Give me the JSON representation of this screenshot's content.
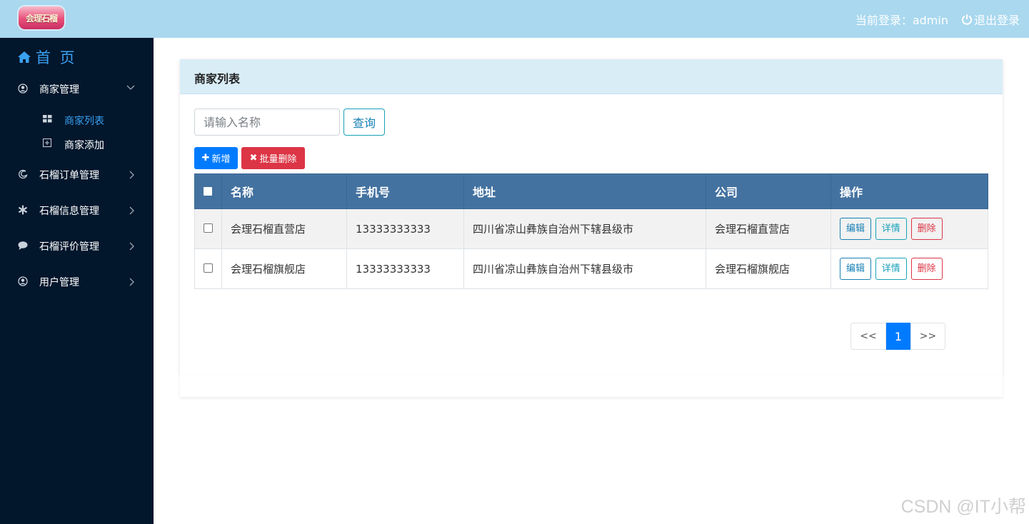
{
  "header": {
    "logo_text": "会理石榴",
    "current_user": "当前登录：admin",
    "logout_label": "退出登录"
  },
  "sidebar": {
    "home_label": "首 页",
    "items": [
      {
        "label": "商家管理",
        "icon": "user-circle-icon",
        "expanded": true
      },
      {
        "label": "石榴订单管理",
        "icon": "edge-icon"
      },
      {
        "label": "石榴信息管理",
        "icon": "asterisk-icon"
      },
      {
        "label": "石榴评价管理",
        "icon": "comment-icon"
      },
      {
        "label": "用户管理",
        "icon": "user-circle-icon"
      }
    ],
    "sub_items": [
      {
        "label": "商家列表",
        "icon": "grid-icon",
        "active": true
      },
      {
        "label": "商家添加",
        "icon": "plus-square-icon"
      }
    ]
  },
  "main": {
    "card_title": "商家列表",
    "search": {
      "placeholder": "请输入名称",
      "value": ""
    },
    "query_label": "查询",
    "add_label": "新增",
    "batch_delete_label": "批量删除",
    "table": {
      "columns": [
        "名称",
        "手机号",
        "地址",
        "公司",
        "操作"
      ],
      "rows": [
        {
          "name": "会理石榴直营店",
          "phone": "13333333333",
          "address": "四川省凉山彝族自治州下辖县级市",
          "company": "会理石榴直营店"
        },
        {
          "name": "会理石榴旗舰店",
          "phone": "13333333333",
          "address": "四川省凉山彝族自治州下辖县级市",
          "company": "会理石榴旗舰店"
        }
      ],
      "actions": {
        "edit": "编辑",
        "detail": "详情",
        "delete": "删除"
      }
    },
    "pagination": {
      "prev": "<<",
      "current": "1",
      "next": ">>"
    }
  },
  "watermark": "CSDN @IT小帮",
  "colors": {
    "topbar": "#a9d8ef",
    "sidebar": "#02162c",
    "table_header": "#4472a0",
    "primary": "#007bff",
    "danger": "#dc3545"
  }
}
